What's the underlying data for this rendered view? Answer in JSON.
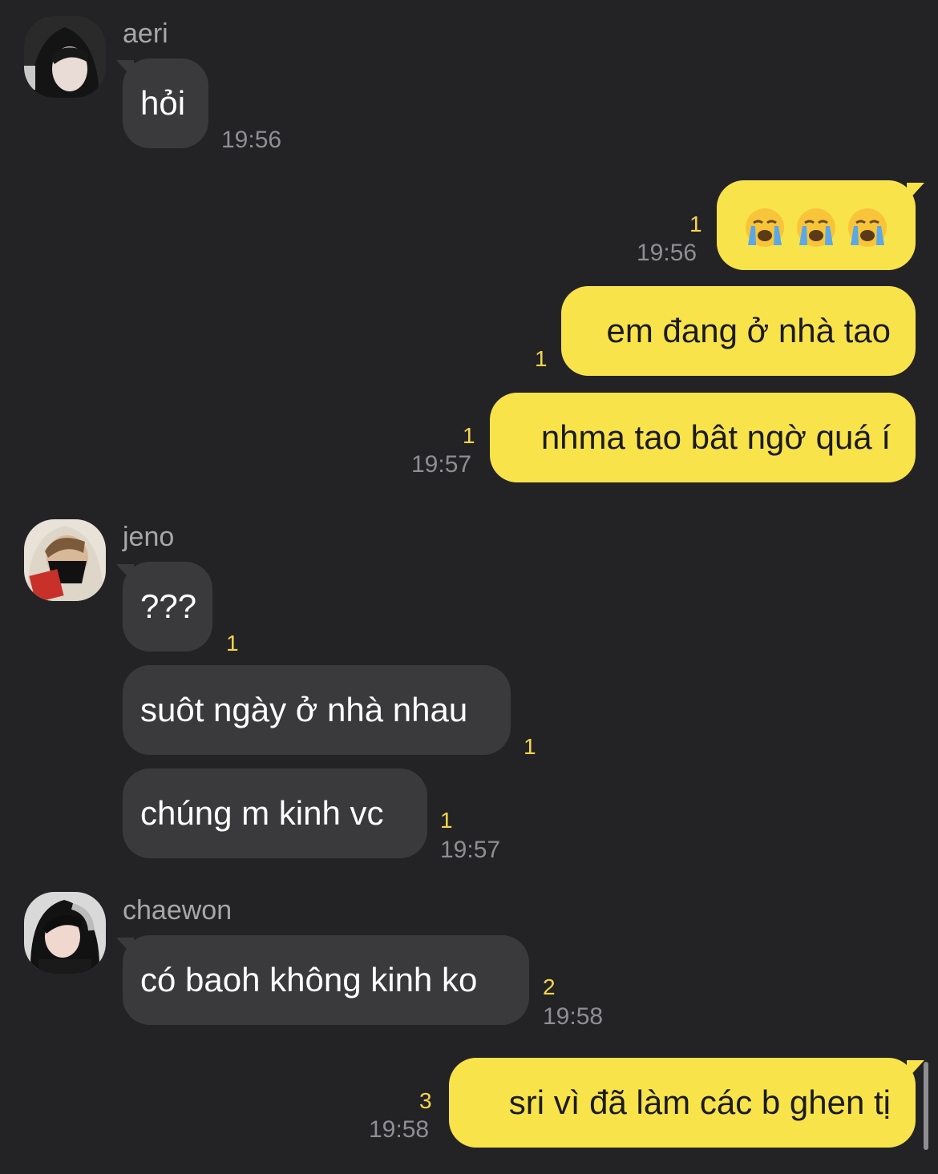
{
  "messages": [
    {
      "sender": "aeri",
      "text": "hỏi",
      "time": "19:56"
    },
    {
      "sender": "me",
      "emoji": [
        "loudly-crying-face",
        "loudly-crying-face",
        "loudly-crying-face"
      ],
      "unread": "1",
      "time": "19:56"
    },
    {
      "sender": "me",
      "text": "em đang ở nhà tao",
      "unread": "1"
    },
    {
      "sender": "me",
      "text": "nhma tao bât ngờ quá í",
      "unread": "1",
      "time": "19:57"
    },
    {
      "sender": "jeno",
      "text": "???",
      "unread": "1"
    },
    {
      "sender": "jeno",
      "text": "suôt ngày ở nhà nhau",
      "unread": "1"
    },
    {
      "sender": "jeno",
      "text": "chúng m kinh vc",
      "unread": "1",
      "time": "19:57"
    },
    {
      "sender": "chaewon",
      "text": "có baoh không kinh ko",
      "unread": "2",
      "time": "19:58"
    },
    {
      "sender": "me",
      "text": "sri vì đã làm các b ghen tị",
      "unread": "3",
      "time": "19:58"
    }
  ],
  "colors": {
    "background": "#232326",
    "incoming_bubble": "#3a3a3d",
    "outgoing_bubble": "#f9e34b",
    "unread_count": "#f5d64a",
    "timestamp": "#8e8e93"
  }
}
